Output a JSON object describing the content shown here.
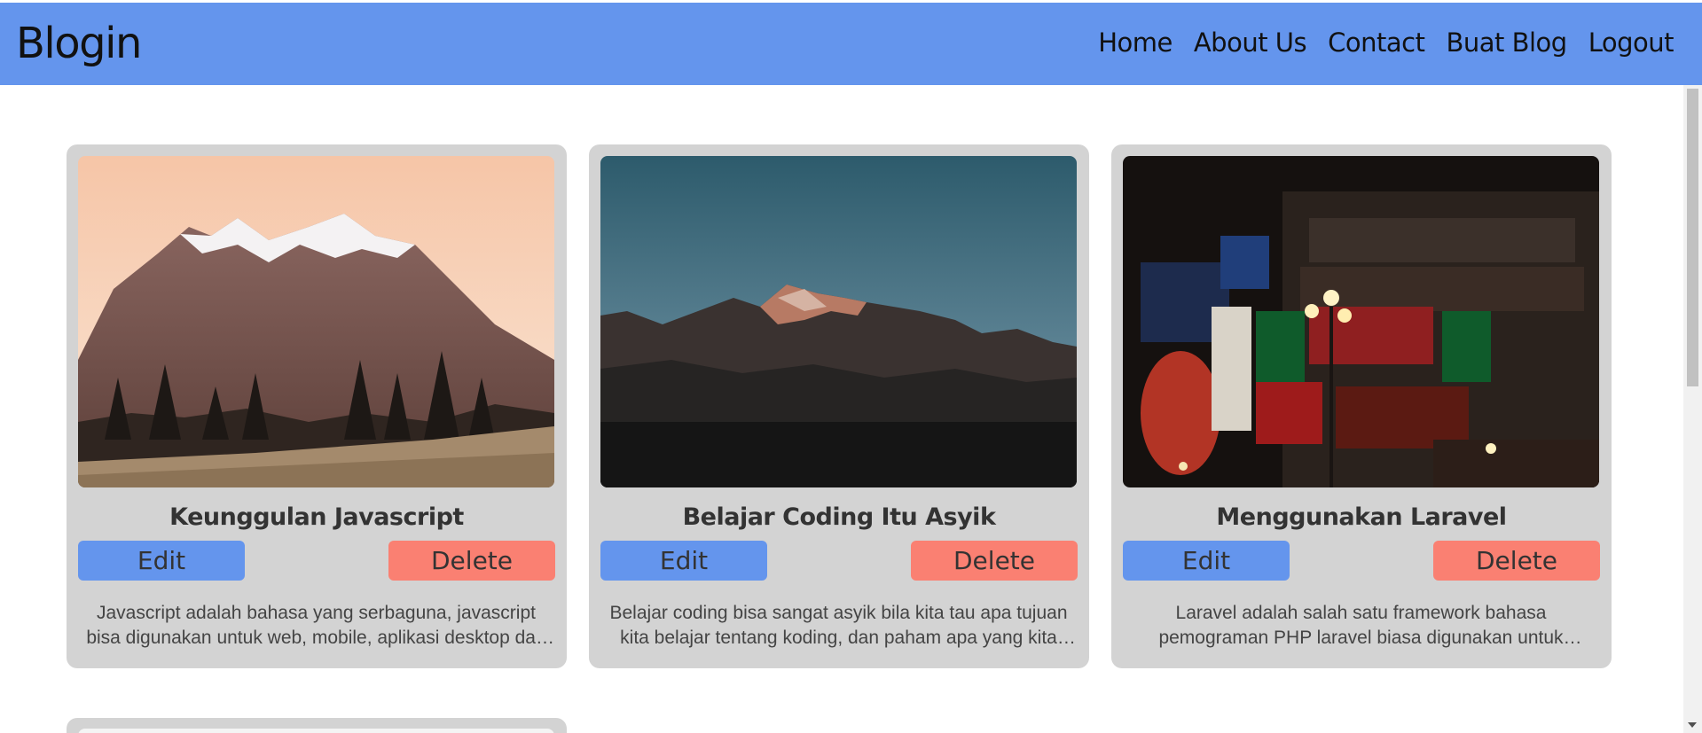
{
  "brand": "Blogin",
  "nav": [
    "Home",
    "About Us",
    "Contact",
    "Buat Blog",
    "Logout"
  ],
  "colors": {
    "navbar": "#6495ED",
    "edit": "#6495ED",
    "delete": "#FA8072",
    "card": "#d3d3d3"
  },
  "posts": [
    {
      "title": "Keunggulan Javascript",
      "edit_label": "Edit",
      "delete_label": "Delete",
      "description": "Javascript adalah bahasa yang serbaguna, javascript bisa digunakan untuk web, mobile, aplikasi desktop dan lainnya"
    },
    {
      "title": "Belajar Coding Itu Asyik",
      "edit_label": "Edit",
      "delete_label": "Delete",
      "description": "Belajar coding bisa sangat asyik bila kita tau apa tujuan kita belajar tentang koding, dan paham apa yang kita pelajari"
    },
    {
      "title": "Menggunakan Laravel",
      "edit_label": "Edit",
      "delete_label": "Delete",
      "description": "Laravel adalah salah satu framework bahasa pemograman PHP laravel biasa digunakan untuk membuat website"
    }
  ]
}
